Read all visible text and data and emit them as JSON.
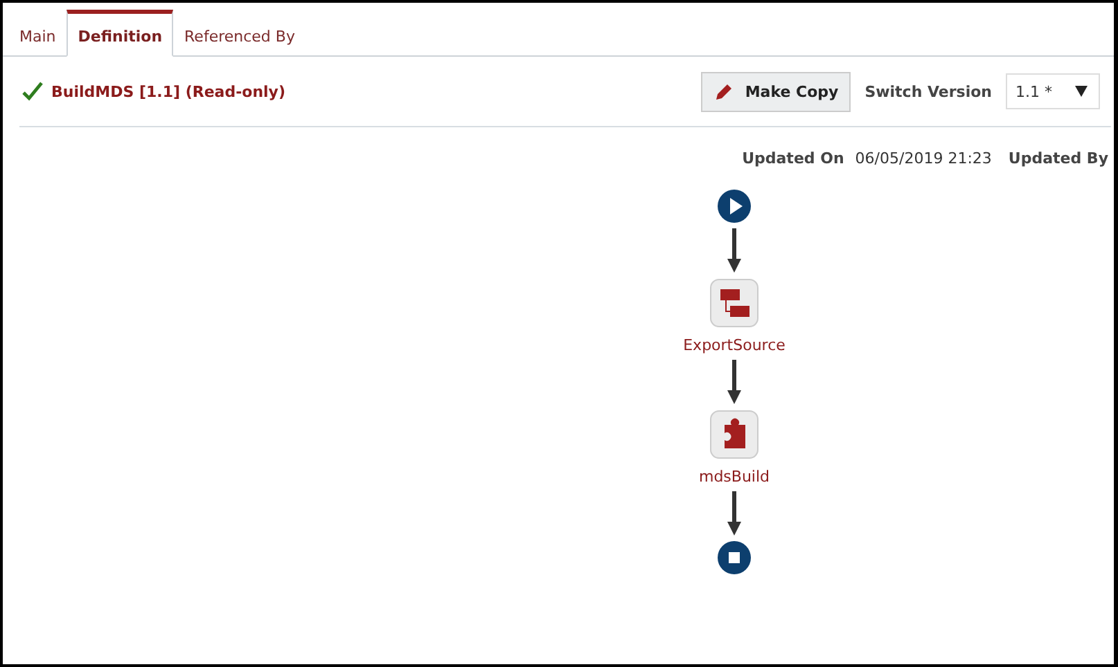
{
  "tabs": [
    {
      "label": "Main",
      "selected": false
    },
    {
      "label": "Definition",
      "selected": true
    },
    {
      "label": "Referenced By",
      "selected": false
    }
  ],
  "header": {
    "title": "BuildMDS [1.1] (Read-only)",
    "make_copy": "Make Copy",
    "switch_label": "Switch Version",
    "version": "1.1 *"
  },
  "meta": {
    "updated_on_label": "Updated On",
    "updated_on": "06/05/2019 21:23",
    "updated_by_label": "Updated By"
  },
  "flow": [
    {
      "kind": "start"
    },
    {
      "kind": "workflow",
      "label": "ExportSource"
    },
    {
      "kind": "plugin",
      "label": "mdsBuild"
    },
    {
      "kind": "end"
    }
  ]
}
